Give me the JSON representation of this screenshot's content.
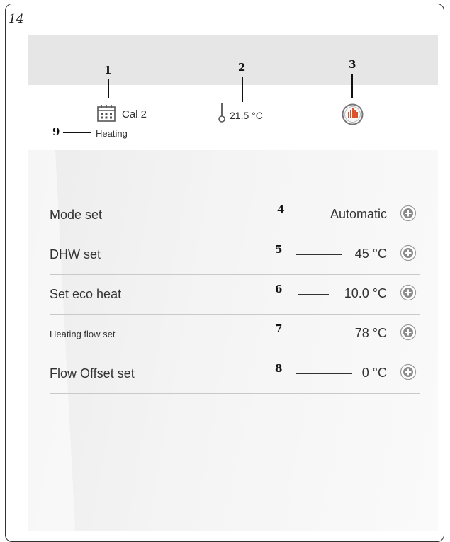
{
  "page_number": "14",
  "callouts": {
    "c1": "1",
    "c2": "2",
    "c3": "3",
    "c9": "9"
  },
  "status": {
    "calendar": "Cal 2",
    "mode": "Heating",
    "temperature": "21.5 °C",
    "heating_icon": "heating-icon"
  },
  "rows": [
    {
      "label": "Mode set",
      "callout": "4",
      "value": "Automatic"
    },
    {
      "label": "DHW set",
      "callout": "5",
      "value": "45 °C"
    },
    {
      "label": "Set eco heat",
      "callout": "6",
      "value": "10.0 °C"
    },
    {
      "label": "Heating flow set",
      "callout": "7",
      "value": "78 °C"
    },
    {
      "label": "Flow Offset set",
      "callout": "8",
      "value": "0 °C"
    }
  ],
  "colors": {
    "heating_accent": "#d9532b"
  }
}
